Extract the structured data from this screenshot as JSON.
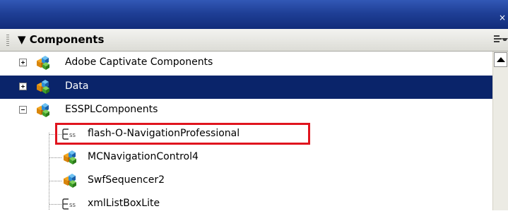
{
  "panel": {
    "close_glyph": "×",
    "header_title": "▼ Components",
    "options_icon": "panel-options-icon"
  },
  "tree": {
    "items": [
      {
        "label": "Adobe Captivate Components",
        "icon": "component-package-icon",
        "expander": "plus",
        "selected": false
      },
      {
        "label": "Data",
        "icon": "component-package-icon",
        "expander": "plus",
        "selected": true
      },
      {
        "label": "ESSPLComponents",
        "icon": "component-package-icon",
        "expander": "minus",
        "selected": false
      },
      {
        "label": "flash-O-NavigationProfessional",
        "icon": "actionscript-class-icon",
        "highlighted": true
      },
      {
        "label": "MCNavigationControl4",
        "icon": "component-package-icon"
      },
      {
        "label": "SwfSequencer2",
        "icon": "component-package-icon"
      },
      {
        "label": "xmlListBoxLite",
        "icon": "actionscript-class-icon"
      }
    ]
  },
  "colors": {
    "titlebar": "#1f3f96",
    "selection": "#0a246a",
    "highlight_border": "#e0141e"
  }
}
